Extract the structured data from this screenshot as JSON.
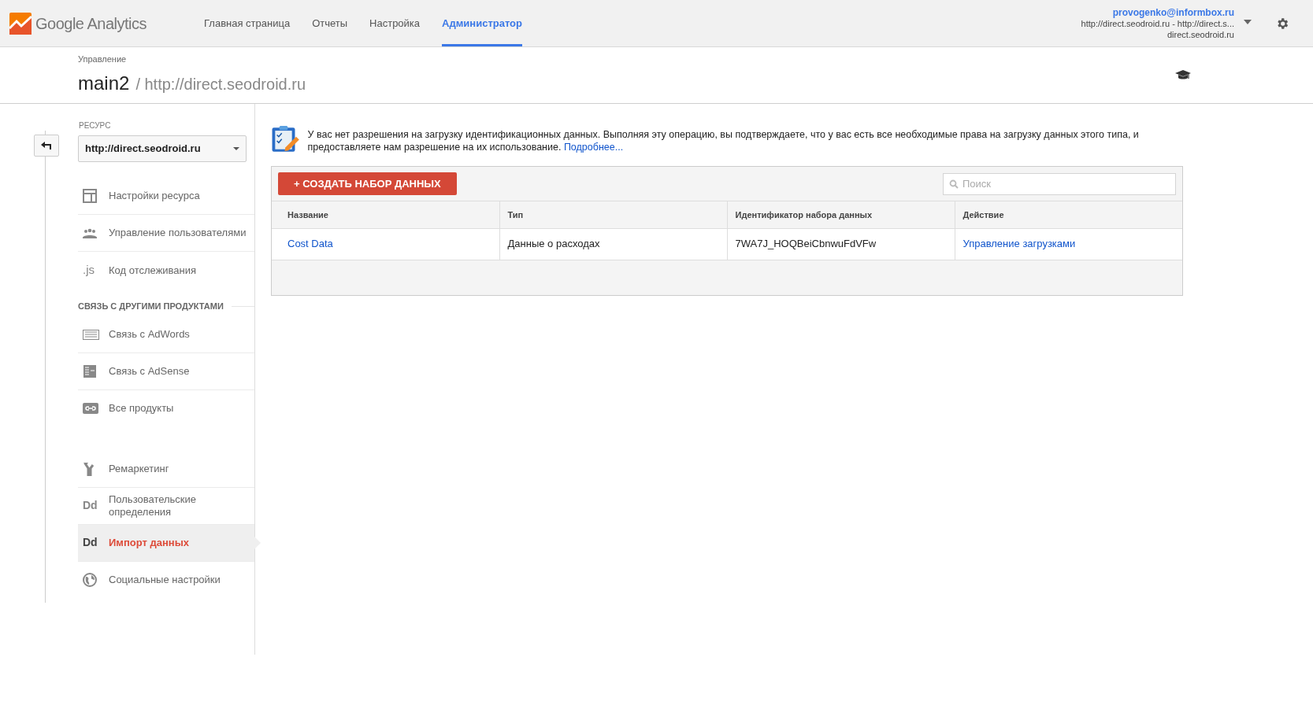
{
  "app": {
    "brand": "Google Analytics"
  },
  "nav": [
    {
      "label": "Главная страница",
      "selected": false
    },
    {
      "label": "Отчеты",
      "selected": false
    },
    {
      "label": "Настройка",
      "selected": false
    },
    {
      "label": "Администратор",
      "selected": true
    }
  ],
  "account": {
    "email": "provogenko@informbox.ru",
    "property": "http://direct.seodroid.ru - http://direct.s...",
    "view": "direct.seodroid.ru"
  },
  "header": {
    "breadcrumb": "Управление",
    "account_name": "main2",
    "property": "/ http://direct.seodroid.ru"
  },
  "sidebar": {
    "resource_label": "РЕСУРС",
    "resource_value": "http://direct.seodroid.ru",
    "groups": [
      {
        "items": [
          {
            "kind": "layout",
            "label": "Настройки ресурса",
            "selected": false
          },
          {
            "kind": "people",
            "label": "Управление пользователями",
            "selected": false
          },
          {
            "kind": "text",
            "glyph": ".js",
            "label": "Код отслеживания",
            "selected": false
          }
        ]
      },
      {
        "heading": "СВЯЗЬ С ДРУГИМИ ПРОДУКТАМИ",
        "items": [
          {
            "kind": "lines",
            "label": "Связь с AdWords",
            "selected": false
          },
          {
            "kind": "columns",
            "label": "Связь с AdSense",
            "selected": false
          },
          {
            "kind": "link",
            "label": "Все продукты",
            "selected": false
          }
        ]
      },
      {
        "items": [
          {
            "kind": "fork",
            "label": "Ремаркетинг",
            "selected": false
          },
          {
            "kind": "text",
            "glyph": "Dd",
            "label": "Пользовательские определения",
            "selected": false
          },
          {
            "kind": "text",
            "glyph": "Dd",
            "label": "Импорт данных",
            "selected": true
          },
          {
            "kind": "globe",
            "label": "Социальные настройки",
            "selected": false
          }
        ]
      }
    ]
  },
  "notice": {
    "text": "У вас нет разрешения на загрузку идентификационных данных. Выполняя эту операцию, вы подтверждаете, что у вас есть все необходимые права на загрузку данных этого типа, и предоставляете нам разрешение на их использование.",
    "link": "Подробнее..."
  },
  "toolbar": {
    "create_button": "+ СОЗДАТЬ НАБОР ДАННЫХ",
    "search": {
      "placeholder": "Поиск"
    }
  },
  "table": {
    "columns": [
      "Название",
      "Тип",
      "Идентификатор набора данных",
      "Действие"
    ],
    "rows": [
      {
        "name": "Cost Data",
        "type": "Данные о расходах",
        "id": "7WA7J_HOQBeiCbnwuFdVFw",
        "action": "Управление загрузками"
      }
    ]
  }
}
